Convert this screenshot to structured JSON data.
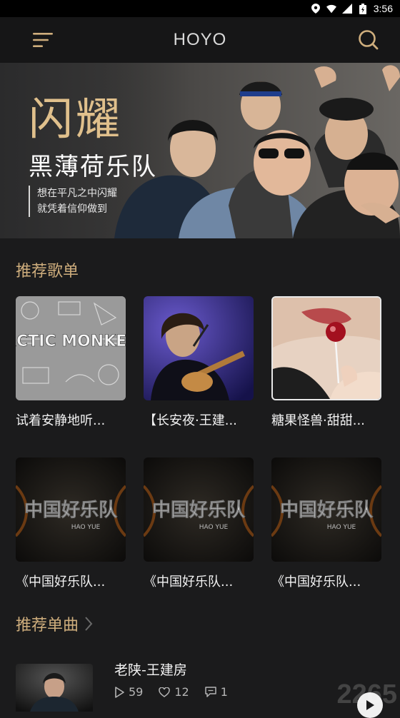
{
  "status_bar": {
    "time": "3:56"
  },
  "header": {
    "title": "HOYO",
    "menu_icon": "hamburger-menu-icon",
    "search_icon": "search-icon"
  },
  "banner": {
    "headline": "闪耀",
    "band": "黑薄荷乐队",
    "slogan_line1": "想在平凡之中闪耀",
    "slogan_line2": "就凭着信仰做到"
  },
  "playlists": {
    "title": "推荐歌单",
    "items": [
      {
        "label": "试着安静地听...",
        "cover_text": "ARCTIC MONKEYS"
      },
      {
        "label": "【长安夜·王建..."
      },
      {
        "label": "糖果怪兽·甜甜..."
      },
      {
        "label": "《中国好乐队...",
        "cover_text": "中国好乐队",
        "cover_sub": "HAO YUE"
      },
      {
        "label": "《中国好乐队...",
        "cover_text": "中国好乐队",
        "cover_sub": "HAO YUE"
      },
      {
        "label": "《中国好乐队...",
        "cover_text": "中国好乐队",
        "cover_sub": "HAO YUE"
      }
    ]
  },
  "singles": {
    "title": "推荐单曲",
    "items": [
      {
        "name": "老陕-王建房",
        "plays": "59",
        "likes": "12",
        "comments": "1"
      }
    ]
  },
  "watermark": "2265",
  "colors": {
    "accent": "#cfae7d",
    "background": "#1b1b1c",
    "header": "#161617"
  }
}
